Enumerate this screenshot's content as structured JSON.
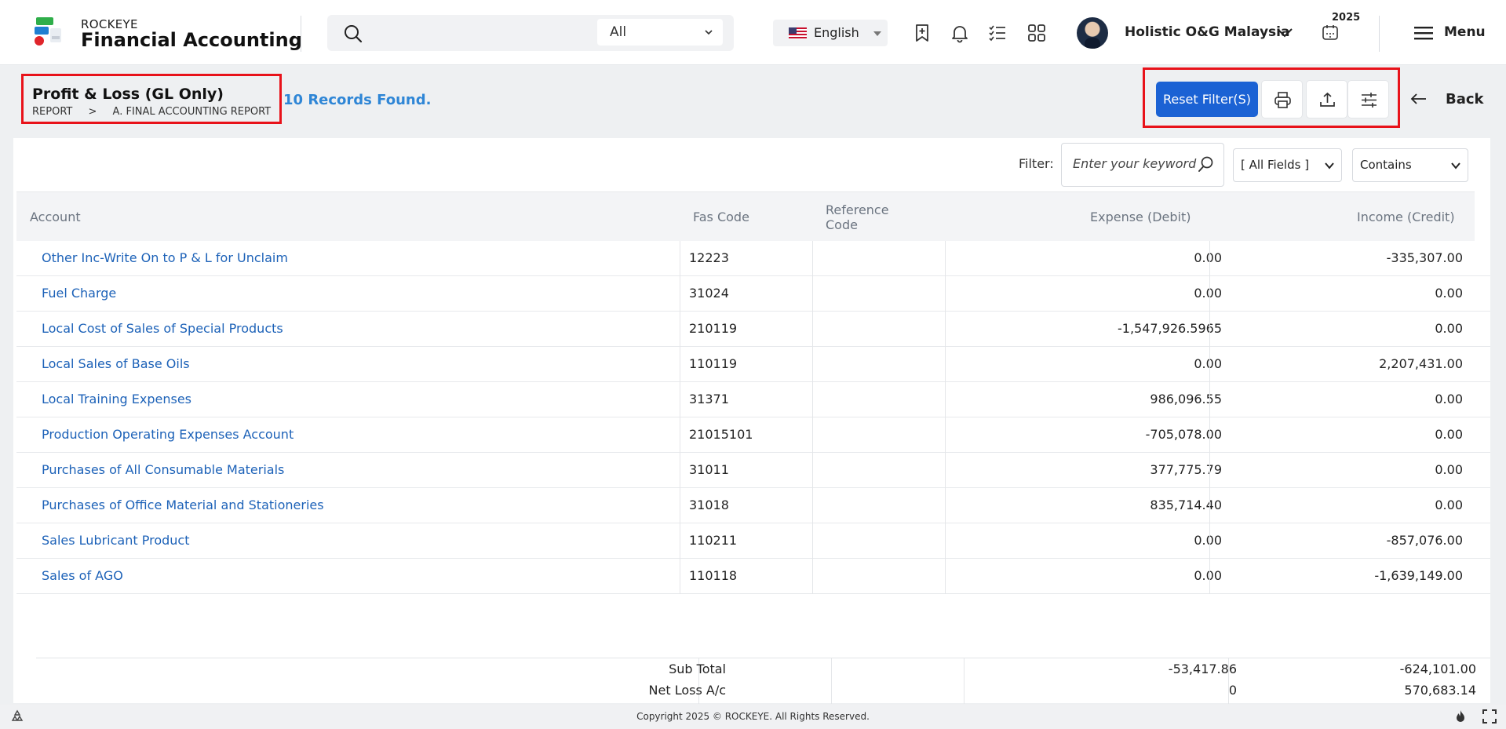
{
  "brand": {
    "small": "ROCKEYE",
    "big": "Financial Accounting"
  },
  "search": {
    "scope": "All"
  },
  "language": {
    "label": "English"
  },
  "user": {
    "company": "Holistic O&G Malaysia",
    "year": "2025"
  },
  "menu": {
    "label": "Menu"
  },
  "page": {
    "title": "Profit & Loss (GL Only)",
    "breadcrumb": [
      "REPORT",
      ">",
      "A. FINAL ACCOUNTING REPORT"
    ],
    "records": "10 Records Found."
  },
  "actions": {
    "reset": "Reset Filter(S)",
    "back": "Back"
  },
  "filter": {
    "label": "Filter:",
    "placeholder": "Enter your keyword",
    "field": "[ All Fields ]",
    "mode": "Contains"
  },
  "table": {
    "columns": [
      "Account",
      "Fas Code",
      "Reference Code",
      "Expense (Debit)",
      "Income (Credit)"
    ],
    "rows": [
      {
        "account": "Other Inc-Write On to P & L for Unclaim",
        "fas": "12223",
        "ref": "",
        "expense": "0.00",
        "income": "-335,307.00"
      },
      {
        "account": "Fuel Charge",
        "fas": "31024",
        "ref": "",
        "expense": "0.00",
        "income": "0.00"
      },
      {
        "account": "Local Cost of Sales of Special Products",
        "fas": "210119",
        "ref": "",
        "expense": "-1,547,926.5965",
        "income": "0.00"
      },
      {
        "account": "Local Sales of Base Oils",
        "fas": "110119",
        "ref": "",
        "expense": "0.00",
        "income": "2,207,431.00"
      },
      {
        "account": "Local Training Expenses",
        "fas": "31371",
        "ref": "",
        "expense": "986,096.55",
        "income": "0.00"
      },
      {
        "account": "Production Operating Expenses Account",
        "fas": "21015101",
        "ref": "",
        "expense": "-705,078.00",
        "income": "0.00"
      },
      {
        "account": "Purchases of All Consumable Materials",
        "fas": "31011",
        "ref": "",
        "expense": "377,775.79",
        "income": "0.00"
      },
      {
        "account": "Purchases of Office Material and Stationeries",
        "fas": "31018",
        "ref": "",
        "expense": "835,714.40",
        "income": "0.00"
      },
      {
        "account": "Sales Lubricant Product",
        "fas": "110211",
        "ref": "",
        "expense": "0.00",
        "income": "-857,076.00"
      },
      {
        "account": "Sales of AGO",
        "fas": "110118",
        "ref": "",
        "expense": "0.00",
        "income": "-1,639,149.00"
      }
    ]
  },
  "totals": {
    "subtotal": {
      "label": "Sub Total",
      "expense": "-53,417.86",
      "income": "-624,101.00"
    },
    "netloss": {
      "label": "Net Loss A/c",
      "expense": "0",
      "income": "570,683.14"
    }
  },
  "footer": {
    "copyright": "Copyright 2025 © ROCKEYE. All Rights Reserved."
  },
  "colors": {
    "primary": "#1b62d4",
    "link": "#1d62b8",
    "records": "#2f86d6",
    "highlight": "#e8121a"
  }
}
